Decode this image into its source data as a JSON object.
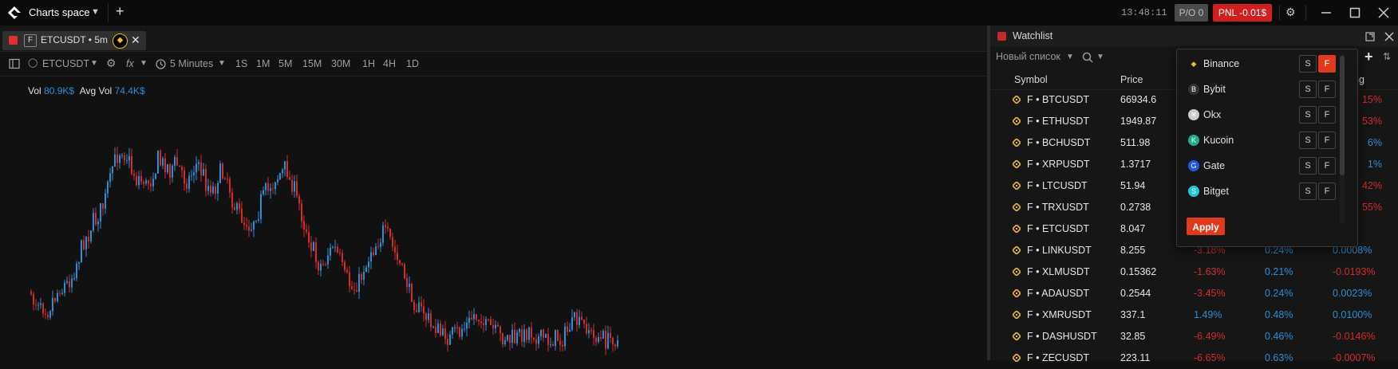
{
  "topbar": {
    "workspace": "Charts space",
    "clock": "13:48:11",
    "po_badge": "P/O 0",
    "pnl_badge": "PNL -0.01$"
  },
  "tab": {
    "f_label": "F",
    "label": "ETCUSDT • 5m",
    "exchange_icon": "binance-icon"
  },
  "toolbar": {
    "symbol": "ETCUSDT",
    "fx": "fx",
    "interval": "5 Minutes",
    "intervals": [
      "1S",
      "1M",
      "5M",
      "15M",
      "30M",
      "1H",
      "4H",
      "1D"
    ]
  },
  "chart": {
    "vol_label": "Vol",
    "vol_value": "80.9K$",
    "avgvol_label": "Avg Vol",
    "avgvol_value": "74.4K$",
    "up_color": "#2b8fd6",
    "down_color": "#d42b2b",
    "profile": [
      0.78,
      0.78,
      0.8,
      0.82,
      0.75,
      0.72,
      0.7,
      0.65,
      0.55,
      0.48,
      0.42,
      0.38,
      0.3,
      0.2,
      0.08,
      0.05,
      0.1,
      0.18,
      0.2,
      0.22,
      0.18,
      0.1,
      0.12,
      0.15,
      0.12,
      0.18,
      0.2,
      0.12,
      0.15,
      0.22,
      0.25,
      0.18,
      0.15,
      0.28,
      0.35,
      0.4,
      0.42,
      0.38,
      0.3,
      0.25,
      0.2,
      0.18,
      0.15,
      0.22,
      0.3,
      0.4,
      0.5,
      0.58,
      0.62,
      0.55,
      0.52,
      0.6,
      0.68,
      0.72,
      0.7,
      0.62,
      0.55,
      0.5,
      0.45,
      0.48,
      0.55,
      0.62,
      0.7,
      0.78,
      0.82,
      0.85,
      0.9,
      0.92,
      0.95,
      0.96,
      0.95,
      0.92,
      0.88,
      0.85,
      0.86,
      0.9,
      0.92,
      0.95,
      0.96,
      0.97,
      0.97,
      0.95,
      0.92,
      0.94,
      0.96,
      0.97,
      0.97,
      0.97,
      0.95,
      0.9,
      0.88,
      0.9,
      0.93,
      0.96,
      0.97,
      0.97,
      0.97,
      0.97
    ]
  },
  "watchlist": {
    "title": "Watchlist",
    "list_name": "Новый список",
    "columns": {
      "symbol": "Symbol",
      "price": "Price",
      "change": "ng"
    },
    "rows": [
      {
        "symbol": "F • BTCUSDT",
        "price": "66934.6",
        "col_right": "15%",
        "right_neg": true
      },
      {
        "symbol": "F • ETHUSDT",
        "price": "1949.87",
        "col_right": "53%",
        "right_neg": true
      },
      {
        "symbol": "F • BCHUSDT",
        "price": "511.98",
        "col_right": "6%",
        "right_neg": false
      },
      {
        "symbol": "F • XRPUSDT",
        "price": "1.3717",
        "col_right": "1%",
        "right_neg": false
      },
      {
        "symbol": "F • LTCUSDT",
        "price": "51.94",
        "col_right": "42%",
        "right_neg": true
      },
      {
        "symbol": "F • TRXUSDT",
        "price": "0.2738",
        "col_right": "55%",
        "right_neg": true
      },
      {
        "symbol": "F • ETCUSDT",
        "price": "8.047",
        "col_right": "",
        "right_neg": false
      },
      {
        "symbol": "F • LINKUSDT",
        "price": "8.255",
        "change": "-3.18%",
        "change_neg": true,
        "vol": "0.24%",
        "funding": "0.0008%",
        "funding_neg": false
      },
      {
        "symbol": "F • XLMUSDT",
        "price": "0.15362",
        "change": "-1.63%",
        "change_neg": true,
        "vol": "0.21%",
        "funding": "-0.0193%",
        "funding_neg": true
      },
      {
        "symbol": "F • ADAUSDT",
        "price": "0.2544",
        "change": "-3.45%",
        "change_neg": true,
        "vol": "0.24%",
        "funding": "0.0023%",
        "funding_neg": false
      },
      {
        "symbol": "F • XMRUSDT",
        "price": "337.1",
        "change": "1.49%",
        "change_neg": false,
        "vol": "0.48%",
        "funding": "0.0100%",
        "funding_neg": false
      },
      {
        "symbol": "F • DASHUSDT",
        "price": "32.85",
        "change": "-6.49%",
        "change_neg": true,
        "vol": "0.46%",
        "funding": "-0.0146%",
        "funding_neg": true
      },
      {
        "symbol": "F • ZECUSDT",
        "price": "223.11",
        "change": "-6.65%",
        "change_neg": true,
        "vol": "0.63%",
        "funding": "-0.0007%",
        "funding_neg": true
      }
    ]
  },
  "exchange_popup": {
    "exchanges": [
      {
        "name": "Binance",
        "icon": "binance-icon",
        "color": "#f3ba2f",
        "spot": "S",
        "futures": "F",
        "futures_active": true
      },
      {
        "name": "Bybit",
        "icon": "bybit-icon",
        "color": "#333333",
        "spot": "S",
        "futures": "F",
        "futures_active": false
      },
      {
        "name": "Okx",
        "icon": "okx-icon",
        "color": "#cccccc",
        "spot": "S",
        "futures": "F",
        "futures_active": false
      },
      {
        "name": "Kucoin",
        "icon": "kucoin-icon",
        "color": "#1fae8c",
        "spot": "S",
        "futures": "F",
        "futures_active": false
      },
      {
        "name": "Gate",
        "icon": "gate-icon",
        "color": "#2354e6",
        "spot": "S",
        "futures": "F",
        "futures_active": false
      },
      {
        "name": "Bitget",
        "icon": "bitget-icon",
        "color": "#1ec6d6",
        "spot": "S",
        "futures": "F",
        "futures_active": false
      }
    ],
    "apply_label": "Apply"
  }
}
